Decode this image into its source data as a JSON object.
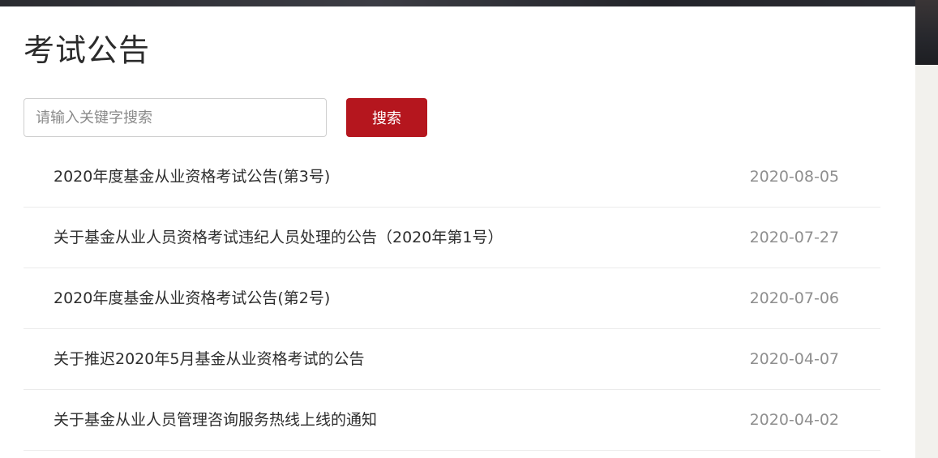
{
  "page": {
    "title": "考试公告"
  },
  "search": {
    "placeholder": "请输入关键字搜索",
    "value": "",
    "button_label": "搜索",
    "button_color": "#b5161e"
  },
  "notices": [
    {
      "title": "2020年度基金从业资格考试公告(第3号)",
      "date": "2020-08-05"
    },
    {
      "title": "关于基金从业人员资格考试违纪人员处理的公告（2020年第1号）",
      "date": "2020-07-27"
    },
    {
      "title": "2020年度基金从业资格考试公告(第2号)",
      "date": "2020-07-06"
    },
    {
      "title": "关于推迟2020年5月基金从业资格考试的公告",
      "date": "2020-04-07"
    },
    {
      "title": "关于基金从业人员管理咨询服务热线上线的通知",
      "date": "2020-04-02"
    }
  ]
}
